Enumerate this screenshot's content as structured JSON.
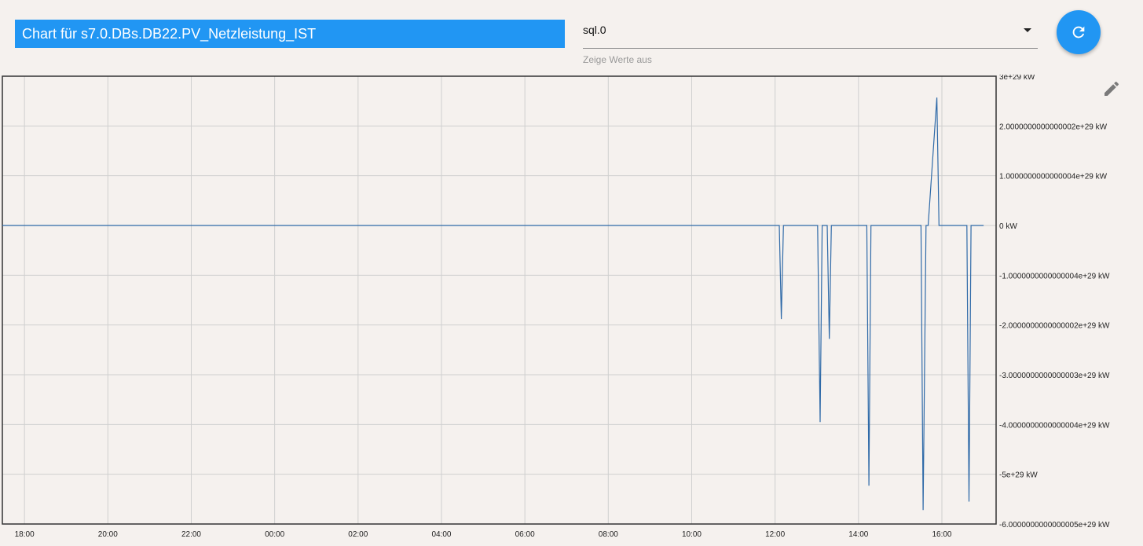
{
  "header": {
    "title": "Chart für s7.0.DBs.DB22.PV_Netzleistung_IST"
  },
  "instance_select": {
    "value": "sql.0",
    "helper": "Zeige Werte aus"
  },
  "icons": {
    "refresh": "refresh-icon",
    "edit": "pencil-icon",
    "dropdown": "arrow-drop-down-icon"
  },
  "colors": {
    "accent": "#2196f3",
    "line": "#2f6aa8",
    "background": "#f5f1ee"
  },
  "chart_data": {
    "type": "line",
    "title": "",
    "x_ticks": [
      "18:00",
      "20:00",
      "22:00",
      "00:00",
      "02:00",
      "04:00",
      "06:00",
      "08:00",
      "10:00",
      "12:00",
      "14:00",
      "16:00"
    ],
    "y_ticks": [
      "3e+29 kW",
      "2.0000000000000002e+29 kW",
      "1.0000000000000004e+29 kW",
      "0 kW",
      "-1.0000000000000004e+29 kW",
      "-2.0000000000000002e+29 kW",
      "-3.0000000000000003e+29 kW",
      "-4.0000000000000004e+29 kW",
      "-5e+29 kW",
      "-6.0000000000000005e+29 kW"
    ],
    "ylim": [
      -6e+29,
      3e+29
    ],
    "xlim_hours": [
      17.47,
      41.3
    ],
    "grid": true,
    "series": [
      {
        "x_hours": [
          17.47,
          36.1,
          36.15,
          36.2,
          36.6,
          37.02,
          37.08,
          37.13,
          37.25,
          37.3,
          37.35,
          38.2,
          38.25,
          38.3,
          38.45,
          39.5,
          39.55,
          39.62,
          39.67,
          39.88,
          39.93,
          39.98,
          40.3,
          40.6,
          40.65,
          40.7,
          40.85,
          41.0
        ],
        "y": [
          0,
          0,
          -1.88e+29,
          0,
          0,
          0,
          -3.95e+29,
          0,
          0,
          -2.28e+29,
          0,
          0,
          -5.23e+29,
          0,
          0,
          0,
          -5.72e+29,
          0,
          0,
          2.57e+29,
          0,
          0,
          0,
          0,
          -5.55e+29,
          0,
          0,
          0
        ]
      }
    ]
  }
}
